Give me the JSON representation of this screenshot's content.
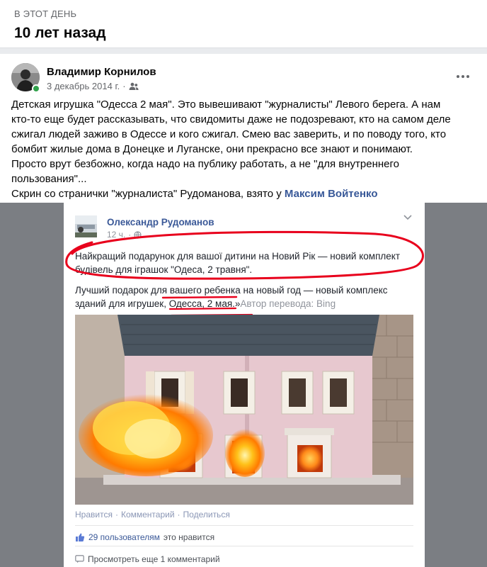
{
  "memory": {
    "kicker": "В ЭТОТ ДЕНЬ",
    "title": "10 лет назад"
  },
  "post": {
    "author": "Владимир Корнилов",
    "date": "3 декабрь 2014 г.",
    "separator": "·",
    "audience_icon": "friends-icon",
    "more_icon": "more-dots-icon",
    "text_lines": [
      "Детская игрушка \"Одесса 2 мая\". Это вывешивают \"журналисты\" Левого берега. А нам",
      "кто-то еще будет рассказывать, что свидомиты даже не подозревают, кто на самом деле",
      "сжигал людей заживо в Одессе и кого сжигал. Смею вас заверить, и по поводу того, кто",
      "бомбит жилые дома в Донецке и Луганске, они прекрасно все знают и понимают.",
      "Просто врут безбожно, когда надо на публику работать, а не \"для внутреннего",
      "пользования\"..."
    ],
    "last_line_prefix": "Скрин со странички \"журналиста\" Рудоманова, взято у ",
    "mention": "Максим Войтенко"
  },
  "screenshot": {
    "author": "Олександр Рудоманов",
    "time": "12 ч.",
    "ukr_line1": "Найкращий подарунок для вашої дитини на Новий Рік — новий комплект",
    "ukr_line2": "будівель для іграшок \"Одеса, 2 травня\".",
    "rus_line1": "Лучший подарок для вашего ребенка на новый год — новый комплекс",
    "rus_line2": "зданий для игрушек, Одесса, 2 мая.»",
    "translation_note": "Автор перевода: Bing",
    "actions": [
      "Нравится",
      "Комментарий",
      "Поделиться"
    ],
    "likes_count": "29 пользователям",
    "likes_suffix": "это нравится",
    "more_comments": "Просмотреть еще 1 комментарий"
  },
  "colors": {
    "link": "#385898",
    "annotation": "#e8001c",
    "online": "#31a24c"
  }
}
